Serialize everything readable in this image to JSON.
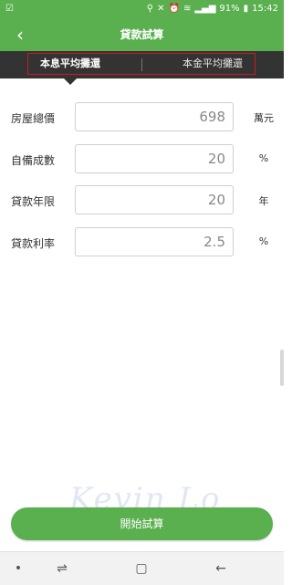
{
  "status_bar": {
    "battery": "91%",
    "time": "15:42",
    "left_icon": "sim-icon",
    "right_icons": [
      "location-icon",
      "mute-icon",
      "alarm-icon",
      "wifi-icon",
      "signal-icon",
      "battery-icon"
    ]
  },
  "app_bar": {
    "title": "貸款試算",
    "back_icon": "back-arrow-icon"
  },
  "tabs": [
    {
      "label": "本息平均攤還",
      "active": true
    },
    {
      "label": "本金平均攤還",
      "active": false
    }
  ],
  "form": {
    "rows": [
      {
        "label": "房屋總價",
        "value": "698",
        "unit": "萬元"
      },
      {
        "label": "自備成數",
        "value": "20",
        "unit": "%"
      },
      {
        "label": "貸款年限",
        "value": "20",
        "unit": "年"
      },
      {
        "label": "貸款利率",
        "value": "2.5",
        "unit": "%"
      }
    ]
  },
  "watermark": "Kevin Lo",
  "start_button": {
    "label": "開始試算"
  },
  "nav_bar": {
    "icons": [
      "dot-icon",
      "recent-apps-icon",
      "home-icon",
      "back-icon"
    ]
  },
  "colors": {
    "primary": "#5aaf4f",
    "tab_bar": "#333333",
    "highlight": "#d0191f"
  }
}
